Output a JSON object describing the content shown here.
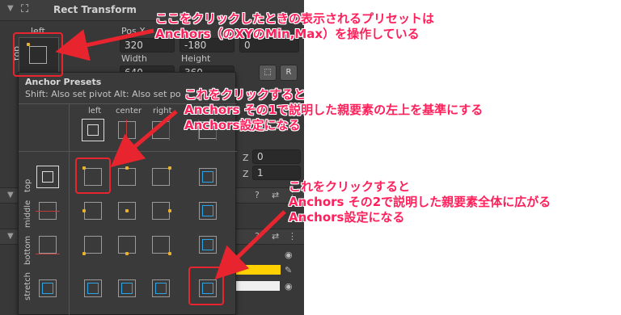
{
  "inspector": {
    "component_title": "Rect Transform",
    "anchor_col_label": "left",
    "anchor_row_label": "top",
    "pos_x_label": "Pos X",
    "pos_x": "320",
    "pos_y": "-180",
    "pos_z": "0",
    "width_label": "Width",
    "height_label": "Height",
    "width": "640",
    "height": "360",
    "blueprint_btn": "",
    "raw_btn": "R",
    "scale_z_label_1": "Z",
    "scale_z_value_1": "0",
    "scale_z_label_2": "Z",
    "scale_z_value_2": "1"
  },
  "popup": {
    "title": "Anchor Presets",
    "shift_hint": "Shift: Also set pivot",
    "alt_hint": "Alt: Also set po",
    "columns": [
      "left",
      "center",
      "right"
    ],
    "rows": [
      "top",
      "middle",
      "bottom",
      "stretch"
    ]
  },
  "annotations": {
    "a1_line1": "ここをクリックしたときの表示されるプリセットは",
    "a1_line2": "Anchors（のXYのMin,Max）を操作している",
    "a2_line1": "これをクリックすると",
    "a2_line2": "Anchors その1で説明した親要素の左上を基準にする",
    "a2_line3": "Anchors設定になる",
    "a3_line1": "これをクリックすると",
    "a3_line2": "Anchors その2で説明した親要素全体に広がる",
    "a3_line3": "Anchors設定になる"
  },
  "colors": {
    "annotation": "#ff1f5a",
    "highlight_box": "#e8252f",
    "anchor_dot": "#e8b32a",
    "stretch_blue": "#2aa6e8",
    "color_swatch": "#ffd000"
  }
}
